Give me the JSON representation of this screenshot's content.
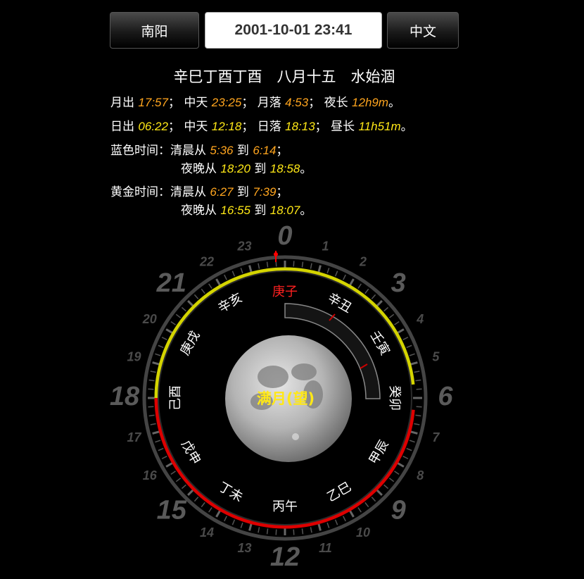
{
  "toolbar": {
    "city_label": "南阳",
    "datetime_value": "2001-10-01 23:41",
    "lang_label": "中文"
  },
  "ganzhi_line": "辛巳丁酉丁酉　八月十五　水始涸",
  "moon_line": {
    "rise_label": "月出",
    "rise": "17:57",
    "transit_label": "中天",
    "transit": "23:25",
    "set_label": "月落",
    "set": "4:53",
    "night_label": "夜长",
    "night": "12h9m"
  },
  "sun_line": {
    "rise_label": "日出",
    "rise": "06:22",
    "transit_label": "中天",
    "transit": "12:18",
    "set_label": "日落",
    "set": "18:13",
    "day_label": "昼长",
    "day": "11h51m"
  },
  "blue_hour": {
    "label": "蓝色时间：",
    "morning_label": "清晨从",
    "morning_from": "5:36",
    "to1": "到",
    "morning_to": "6:14",
    "evening_label": "夜晚从",
    "evening_from": "18:20",
    "to2": "到",
    "evening_to": "18:58"
  },
  "golden_hour": {
    "label": "黄金时间：",
    "morning_label": "清晨从",
    "morning_from": "6:27",
    "to1": "到",
    "morning_to": "7:39",
    "evening_label": "夜晚从",
    "evening_from": "16:55",
    "to2": "到",
    "evening_to": "18:07"
  },
  "dial": {
    "hour_numbers": [
      "0",
      "1",
      "2",
      "3",
      "4",
      "5",
      "6",
      "7",
      "8",
      "9",
      "10",
      "11",
      "12",
      "13",
      "14",
      "15",
      "16",
      "17",
      "18",
      "19",
      "20",
      "21",
      "22",
      "23"
    ],
    "branches": [
      {
        "text": "庚子",
        "hour": 0,
        "current": true
      },
      {
        "text": "辛丑",
        "hour": 2
      },
      {
        "text": "壬寅",
        "hour": 4
      },
      {
        "text": "癸卯",
        "hour": 6
      },
      {
        "text": "甲辰",
        "hour": 8
      },
      {
        "text": "乙巳",
        "hour": 10
      },
      {
        "text": "丙午",
        "hour": 12
      },
      {
        "text": "丁未",
        "hour": 14
      },
      {
        "text": "戊申",
        "hour": 16
      },
      {
        "text": "己酉",
        "hour": 18
      },
      {
        "text": "庚戌",
        "hour": 20
      },
      {
        "text": "辛亥",
        "hour": 22
      }
    ],
    "moon_phase": "满月(望)",
    "colors": {
      "day": "#d4d400",
      "night": "#dd0000",
      "current": "#ff2020",
      "phase": "#ffe816"
    }
  }
}
